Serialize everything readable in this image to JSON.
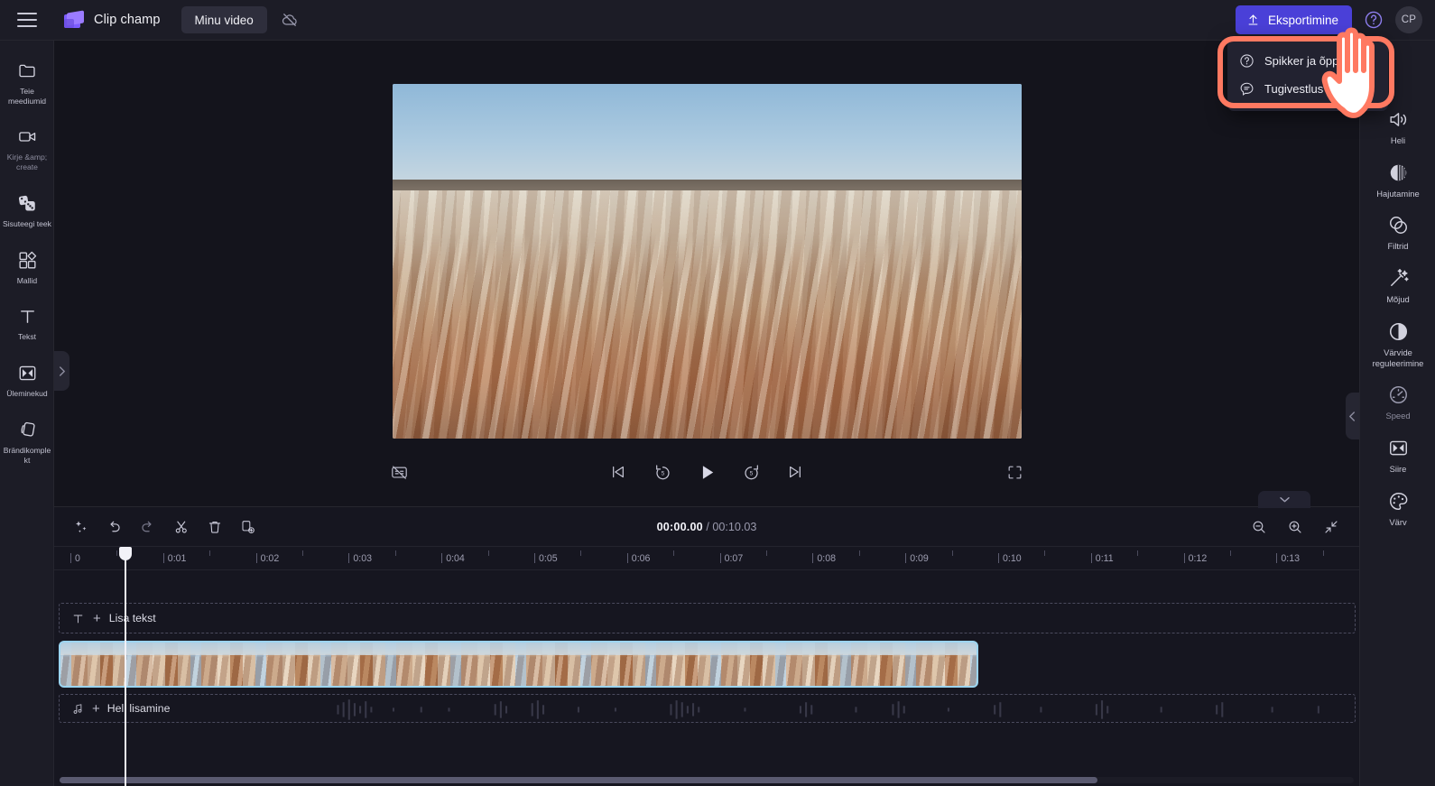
{
  "app": {
    "brand": "Clip champ",
    "project_name": "Minu video",
    "accent_color": "#4a40d8",
    "highlight_color": "#ff7961",
    "background_color": "#14141c",
    "panel_color": "#1c1c26"
  },
  "topbar": {
    "menu_icon": "hamburger-icon",
    "logo_icon": "clipchamp-logo-icon",
    "sync_icon": "cloud-offline-icon",
    "export_label": "Eksportimine",
    "export_icon": "upload-icon",
    "help_icon": "question-circle-icon",
    "avatar_initials": "CP"
  },
  "help_menu": {
    "items": [
      {
        "label": "Spikker ja õppimine",
        "icon": "question-circle-icon"
      },
      {
        "label": "Tugivestlus",
        "icon": "chat-bubble-icon"
      }
    ]
  },
  "left_rail": {
    "collapse_icon": "chevron-right-icon",
    "items": [
      {
        "label": "Teie meediumid",
        "icon": "folder-icon",
        "dim": false
      },
      {
        "label": "Kirje &amp; create",
        "icon": "video-camera-icon",
        "dim": true
      },
      {
        "label": "Sisuteegi teek",
        "icon": "content-library-icon",
        "dim": false
      },
      {
        "label": "Mallid",
        "icon": "templates-icon",
        "dim": false
      },
      {
        "label": "Tekst",
        "icon": "text-icon",
        "dim": false
      },
      {
        "label": "Üleminekud",
        "icon": "transitions-icon",
        "dim": false
      },
      {
        "label": "Brändikomplekt",
        "icon": "brand-kit-icon",
        "dim": false
      }
    ]
  },
  "right_rail": {
    "collapse_icon": "chevron-left-icon",
    "items": [
      {
        "label": "Heli",
        "icon": "speaker-icon",
        "dim": false
      },
      {
        "label": "Hajutamine",
        "icon": "fade-icon",
        "dim": false
      },
      {
        "label": "Filtrid",
        "icon": "filters-icon",
        "dim": false
      },
      {
        "label": "Mõjud",
        "icon": "effects-wand-icon",
        "dim": false
      },
      {
        "label": "Värvide reguleerimine",
        "icon": "color-adjust-icon",
        "dim": false
      },
      {
        "label": "Speed",
        "icon": "speedometer-icon",
        "dim": true
      },
      {
        "label": "Siire",
        "icon": "transitions-icon",
        "dim": false
      },
      {
        "label": "Värv",
        "icon": "palette-icon",
        "dim": false
      }
    ]
  },
  "player": {
    "captions_icon": "captions-off-icon",
    "skip_back_icon": "skip-previous-icon",
    "rewind_icon": "rewind-5-icon",
    "play_icon": "play-icon",
    "forward_icon": "forward-5-icon",
    "skip_forward_icon": "skip-next-icon",
    "fullscreen_icon": "fullscreen-icon"
  },
  "timeline": {
    "tools": [
      {
        "name": "magic-wand-icon"
      },
      {
        "name": "undo-icon"
      },
      {
        "name": "redo-icon"
      },
      {
        "name": "split-scissors-icon"
      },
      {
        "name": "delete-trash-icon"
      },
      {
        "name": "duplicate-icon"
      }
    ],
    "current_time": "00:00.00",
    "time_separator": " / ",
    "total_time": "00:10.03",
    "zoom_out_icon": "zoom-out-icon",
    "zoom_in_icon": "zoom-in-icon",
    "fit_icon": "fit-to-screen-icon",
    "collapse_icon": "chevron-down-icon",
    "ruler_labels": [
      "0",
      "0:01",
      "0:02",
      "0:03",
      "0:04",
      "0:05",
      "0:06",
      "0:07",
      "0:08",
      "0:09",
      "0:10",
      "0:11",
      "0:12",
      "0:13"
    ],
    "text_track": {
      "label": "Lisa tekst",
      "plus": "+",
      "icon": "text-icon"
    },
    "audio_track": {
      "label": "Heli lisamine",
      "plus": "+",
      "icon": "music-note-icon"
    },
    "video_clip": {
      "selected": true
    }
  }
}
